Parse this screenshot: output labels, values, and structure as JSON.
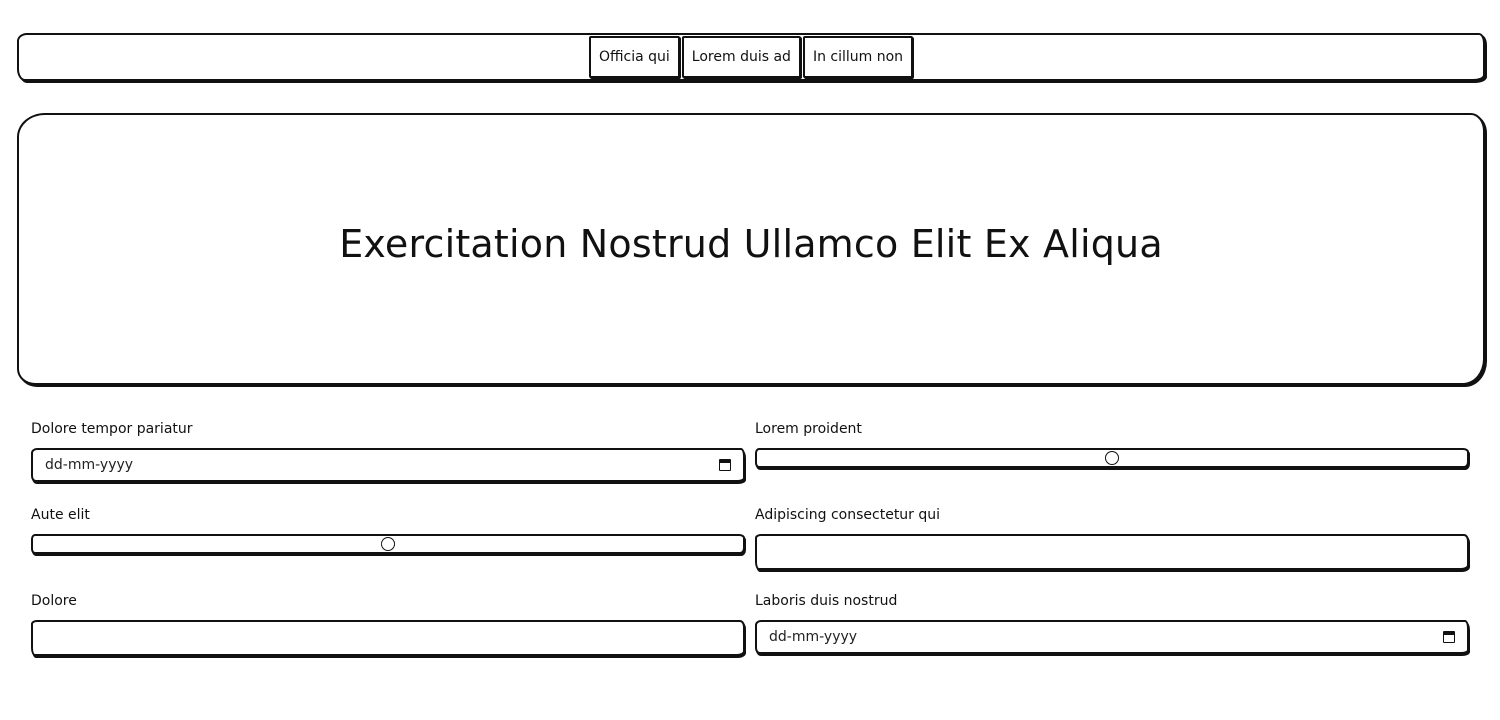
{
  "nav": {
    "tabs": [
      {
        "label": "Officia qui"
      },
      {
        "label": "Lorem duis ad"
      },
      {
        "label": "In cillum non"
      }
    ]
  },
  "hero": {
    "title": "Exercitation Nostrud Ullamco Elit Ex Aliqua"
  },
  "form": {
    "fields": [
      {
        "label": "Dolore tempor pariatur",
        "type": "date",
        "placeholder": "dd-mm-yyyy"
      },
      {
        "label": "Lorem proident",
        "type": "range",
        "value_fraction": 0.5
      },
      {
        "label": "Aute elit",
        "type": "range",
        "value_fraction": 0.5
      },
      {
        "label": "Adipiscing consectetur qui",
        "type": "text",
        "value": ""
      },
      {
        "label": "Dolore",
        "type": "text",
        "value": ""
      },
      {
        "label": "Laboris duis nostrud",
        "type": "date",
        "placeholder": "dd-mm-yyyy"
      }
    ]
  },
  "icons": {
    "date_picker": "calendar-icon",
    "range_thumb": "slider-thumb"
  }
}
